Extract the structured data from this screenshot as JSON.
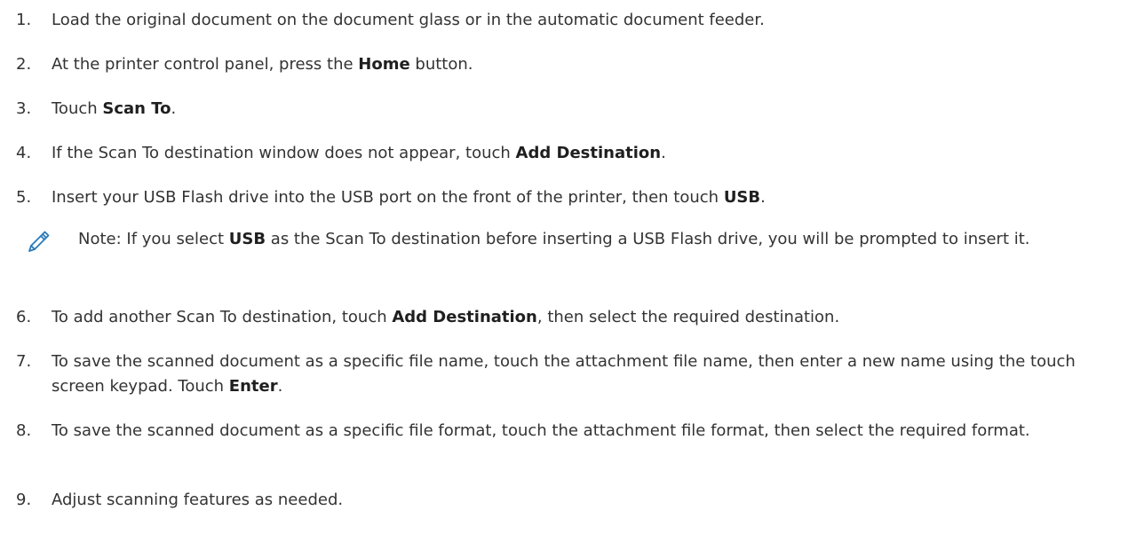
{
  "steps": [
    {
      "num": "1.",
      "t1": "Load the original document on the document glass or in the automatic document feeder."
    },
    {
      "num": "2.",
      "t1": "At the printer control panel, press the ",
      "b1": "Home",
      "t2": " button."
    },
    {
      "num": "3.",
      "t1": "Touch ",
      "b1": "Scan To",
      "t2": "."
    },
    {
      "num": "4.",
      "t1": "If the Scan To destination window does not appear, touch ",
      "b1": "Add Destination",
      "t2": "."
    },
    {
      "num": "5.",
      "t1": "Insert your USB Flash drive into the USB port on the front of the printer, then touch ",
      "b1": "USB",
      "t2": "."
    },
    {
      "num": "6.",
      "t1": "To add another Scan To destination, touch ",
      "b1": "Add Destination",
      "t2": ", then select the required destination."
    },
    {
      "num": "7.",
      "t1": "To save the scanned document as a specific file name, touch the attachment file name, then enter a new name using the touch screen keypad. Touch ",
      "b1": "Enter",
      "t2": "."
    },
    {
      "num": "8.",
      "t1": "To save the scanned document as a specific file format, touch the attachment file format, then select the required format."
    },
    {
      "num": "9.",
      "t1": "Adjust scanning features as needed."
    }
  ],
  "note": {
    "icon": "pencil-icon",
    "t1": "Note: If you select ",
    "b1": "USB",
    "t2": " as the Scan To destination before inserting a USB Flash drive, you will be prompted to insert it.",
    "icon_color": "#2a7ab8"
  }
}
